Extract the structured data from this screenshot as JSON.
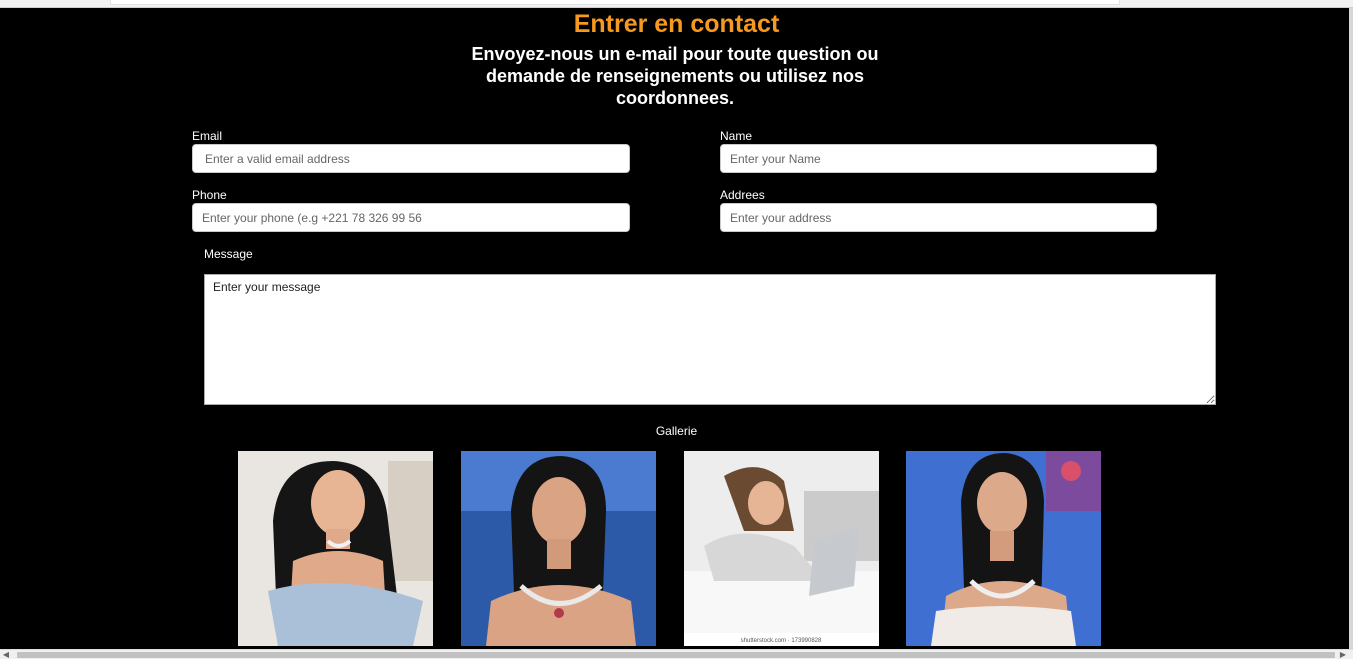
{
  "header": {
    "title": "Entrer en contact",
    "subtitle": "Envoyez-nous un e-mail pour toute question ou demande de renseignements ou utilisez nos coordonnees."
  },
  "form": {
    "email": {
      "label": "Email",
      "placeholder": "Enter a valid email address"
    },
    "name": {
      "label": "Name",
      "placeholder": "Enter your Name"
    },
    "phone": {
      "label": "Phone",
      "placeholder": "Enter your phone (e.g +221 78 326 99 56"
    },
    "address": {
      "label": "Addrees",
      "placeholder": "Enter your address"
    },
    "message": {
      "label": "Message",
      "placeholder": "Enter your message"
    }
  },
  "gallery": {
    "title": "Gallerie",
    "photos": [
      {
        "name": "gallery-photo-1"
      },
      {
        "name": "gallery-photo-2"
      },
      {
        "name": "gallery-photo-3",
        "caption": "shutterstock.com · 173990828"
      },
      {
        "name": "gallery-photo-4"
      }
    ]
  },
  "scrollbar": {
    "left_arrow": "◀",
    "right_arrow": "▶"
  }
}
